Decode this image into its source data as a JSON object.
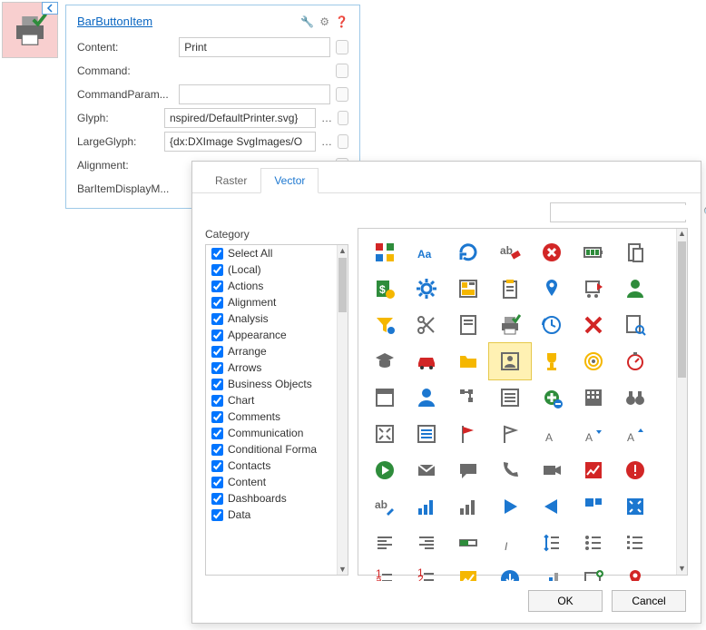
{
  "preview": {
    "icon": "printer-check-icon"
  },
  "props": {
    "title": "BarButtonItem",
    "tools": [
      "wrench-icon",
      "gear-icon",
      "help-icon"
    ],
    "rows": [
      {
        "label": "Content:",
        "value": "Print",
        "hasInput": true,
        "hasEllipsis": false
      },
      {
        "label": "Command:",
        "value": "",
        "hasInput": false,
        "hasEllipsis": false
      },
      {
        "label": "CommandParam...",
        "value": "",
        "hasInput": true,
        "hasEllipsis": false
      },
      {
        "label": "Glyph:",
        "value": "nspired/DefaultPrinter.svg} ",
        "hasInput": true,
        "hasEllipsis": true
      },
      {
        "label": "LargeGlyph:",
        "value": "{dx:DXImage SvgImages/O",
        "hasInput": true,
        "hasEllipsis": true
      },
      {
        "label": "Alignment:",
        "value": "",
        "hasInput": false,
        "hasEllipsis": false
      },
      {
        "label": "BarItemDisplayM...",
        "value": "",
        "hasInput": false,
        "hasEllipsis": false
      }
    ]
  },
  "picker": {
    "tabs": [
      {
        "label": "Raster",
        "active": false
      },
      {
        "label": "Vector",
        "active": true
      }
    ],
    "search_placeholder": "",
    "category_label": "Category",
    "categories": [
      "Select All",
      "(Local)",
      "Actions",
      "Alignment",
      "Analysis",
      "Appearance",
      "Arrange",
      "Arrows",
      "Business Objects",
      "Chart",
      "Comments",
      "Communication",
      "Conditional Forma",
      "Contacts",
      "Content",
      "Dashboards",
      "Data"
    ],
    "icons_selected_index": 24,
    "icons": [
      {
        "n": "grid-colors-icon",
        "t": "grid4"
      },
      {
        "n": "font-icon",
        "t": "aa-blue"
      },
      {
        "n": "refresh-icon",
        "t": "refresh-blue"
      },
      {
        "n": "erase-text-icon",
        "t": "ab-erase"
      },
      {
        "n": "close-circle-icon",
        "t": "x-circle-red"
      },
      {
        "n": "battery-icon",
        "t": "battery-green"
      },
      {
        "n": "paste-icon",
        "t": "paste-gray"
      },
      {
        "n": "dollar-shield-icon",
        "t": "dollar-green"
      },
      {
        "n": "gear-icon",
        "t": "gear-blue"
      },
      {
        "n": "layout-icon",
        "t": "layout-yellow"
      },
      {
        "n": "clipboard-icon",
        "t": "clipboard-yellow"
      },
      {
        "n": "pin-icon",
        "t": "pin-blue"
      },
      {
        "n": "cart-icon",
        "t": "cart-red"
      },
      {
        "n": "user-icon",
        "t": "user-green"
      },
      {
        "n": "filter-icon",
        "t": "filter-yellow"
      },
      {
        "n": "cut-icon",
        "t": "scissors-gray"
      },
      {
        "n": "page-icon",
        "t": "page-gray"
      },
      {
        "n": "printer-check-icon",
        "t": "printer-check"
      },
      {
        "n": "history-icon",
        "t": "clock-blue"
      },
      {
        "n": "x-icon",
        "t": "x-red"
      },
      {
        "n": "page-search-icon",
        "t": "page-search"
      },
      {
        "n": "graduate-icon",
        "t": "grad-gray"
      },
      {
        "n": "car-icon",
        "t": "car-red"
      },
      {
        "n": "folder-icon",
        "t": "folder-yellow"
      },
      {
        "n": "contact-icon",
        "t": "contact-gray"
      },
      {
        "n": "trophy-icon",
        "t": "trophy-yellow"
      },
      {
        "n": "target-icon",
        "t": "target-yellow"
      },
      {
        "n": "stopwatch-icon",
        "t": "stopwatch-red"
      },
      {
        "n": "window-icon",
        "t": "window-gray"
      },
      {
        "n": "user2-icon",
        "t": "user-blue"
      },
      {
        "n": "tree-icon",
        "t": "tree-gray"
      },
      {
        "n": "list-icon",
        "t": "list-gray"
      },
      {
        "n": "add-circle-icon",
        "t": "plus-green"
      },
      {
        "n": "keypad-icon",
        "t": "keypad-gray"
      },
      {
        "n": "binoculars-icon",
        "t": "binoc-gray"
      },
      {
        "n": "expand-icon",
        "t": "expand-gray"
      },
      {
        "n": "list-blue-icon",
        "t": "list-blue"
      },
      {
        "n": "flag-red-icon",
        "t": "flag-red"
      },
      {
        "n": "flag-gray-icon",
        "t": "flag-gray"
      },
      {
        "n": "letter-a-icon",
        "t": "a-gray"
      },
      {
        "n": "a-small-icon",
        "t": "a-dec"
      },
      {
        "n": "a-big-icon",
        "t": "a-inc"
      },
      {
        "n": "play-circle-icon",
        "t": "play-green"
      },
      {
        "n": "mail-icon",
        "t": "mail-gray"
      },
      {
        "n": "chat-icon",
        "t": "chat-gray"
      },
      {
        "n": "phone-icon",
        "t": "phone-gray"
      },
      {
        "n": "video-icon",
        "t": "video-gray"
      },
      {
        "n": "chart-up-icon",
        "t": "chart-red"
      },
      {
        "n": "alert-icon",
        "t": "alert-red"
      },
      {
        "n": "text-edit-icon",
        "t": "ab-pencil"
      },
      {
        "n": "bars-blue-icon",
        "t": "bars-blue"
      },
      {
        "n": "bars-gray-icon",
        "t": "bars-gray"
      },
      {
        "n": "play-right-icon",
        "t": "tri-right-blue"
      },
      {
        "n": "play-left-icon",
        "t": "tri-left-blue"
      },
      {
        "n": "panel-icon",
        "t": "panel-blue"
      },
      {
        "n": "shrink-icon",
        "t": "shrink-blue"
      },
      {
        "n": "align-left-icon",
        "t": "align-l"
      },
      {
        "n": "align-right-icon",
        "t": "align-r"
      },
      {
        "n": "progress-icon",
        "t": "progress-green"
      },
      {
        "n": "italic-icon",
        "t": "italic"
      },
      {
        "n": "line-spacing-icon",
        "t": "spacing-blue"
      },
      {
        "n": "bullets-icon",
        "t": "bullets"
      },
      {
        "n": "bullets2-icon",
        "t": "bullets2"
      },
      {
        "n": "numlist-red-icon",
        "t": "numlist-red"
      },
      {
        "n": "numlist2-icon",
        "t": "numlist-red2"
      },
      {
        "n": "chart-box-icon",
        "t": "chartbox-yellow"
      },
      {
        "n": "down-circle-icon",
        "t": "down-blue"
      },
      {
        "n": "bars2-icon",
        "t": "bars-mix"
      },
      {
        "n": "panel-plus-icon",
        "t": "panel-green"
      },
      {
        "n": "map-pin-icon",
        "t": "pin-red"
      }
    ],
    "buttons": {
      "ok": "OK",
      "cancel": "Cancel"
    }
  }
}
